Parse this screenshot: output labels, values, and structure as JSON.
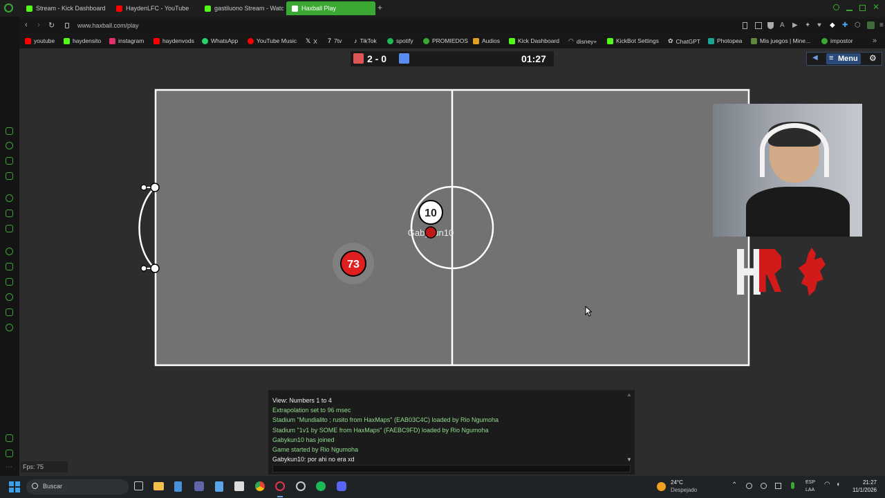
{
  "browser": {
    "tabs": [
      {
        "label": "Stream - Kick Dashboard",
        "color": "#53fc18"
      },
      {
        "label": "HaydenLFC - YouTube",
        "color": "#ff0000"
      },
      {
        "label": "gastiluono Stream - Watch",
        "color": "#53fc18"
      },
      {
        "label": "Haxball Play",
        "color": "#3aa832"
      }
    ],
    "new_tab": "+",
    "url": "www.haxball.com/play",
    "bookmarks": [
      "youtube",
      "haydensito",
      "instagram",
      "haydenvods",
      "WhatsApp",
      "YouTube Music",
      "X",
      "7tv",
      "TikTok",
      "spotify",
      "PROMIEDOS",
      "Audios",
      "Kick Dashboard",
      "disney+",
      "KickBot Settings",
      "ChatGPT",
      "Photopea",
      "Mis juegos | Mine...",
      "impostor"
    ]
  },
  "scoreboard": {
    "score": "2 - 0",
    "time": "01:27",
    "red": "#e05555",
    "blue": "#5a8cf0"
  },
  "menu": {
    "label": "Menu"
  },
  "players": [
    {
      "number": "10",
      "name": "Gabykun10",
      "team": "blue"
    },
    {
      "number": "73",
      "team": "red"
    }
  ],
  "chat": {
    "lines": [
      {
        "text": "View: Numbers 1 to 4",
        "color": "#f0f0f0"
      },
      {
        "text": "Extrapolation set to 96 msec",
        "color": "#90dc8c"
      },
      {
        "text": "Stadium \"Mundialito ; rusito from HaxMaps\" (EAB03C4C) loaded by Rio Ngumoha",
        "color": "#90dc8c"
      },
      {
        "text": "Stadium \"1v1 by SOME from HaxMaps\" (FAEBC9FD) loaded by Rio Ngumoha",
        "color": "#90dc8c"
      },
      {
        "text": "Gabykun10 has joined",
        "color": "#90dc8c"
      },
      {
        "text": "Game started by Rio Ngumoha",
        "color": "#90dc8c"
      },
      {
        "text": "Gabykun10: por ahi no era xd",
        "color": "#f0f0f0"
      }
    ]
  },
  "fps": "Fps: 75",
  "taskbar": {
    "search": "Buscar",
    "weather_temp": "24°C",
    "weather_desc": "Despejado",
    "lang1": "ESP",
    "lang2": "LAA",
    "time": "21:27",
    "date": "11/1/2026"
  }
}
